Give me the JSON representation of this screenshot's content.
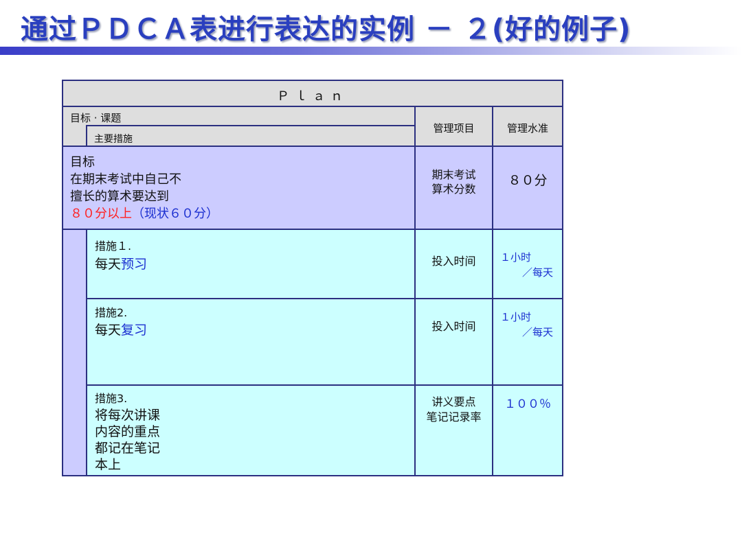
{
  "slide": {
    "title": "通过ＰＤＣＡ表进行表达的实例 － ２(好的例子)"
  },
  "table": {
    "header": "Ｐｌａｎ",
    "col1_header": "目标 · 课题",
    "col1_subheader": "主要措施",
    "col2_header": "管理项目",
    "col3_header": "管理水准",
    "goal": {
      "label": "目标",
      "line1": "在期末考试中自己不",
      "line2": "擅长的算术要达到",
      "target_red": "８０分以上",
      "status_blue": "（现状６０分）",
      "item_line1": "期末考试",
      "item_line2": "算术分数",
      "level": "８０分"
    },
    "measures": [
      {
        "label": "措施１.",
        "text_black": "每天",
        "text_blue": "预习",
        "item": "投入时间",
        "level_line1": "１小时",
        "level_line2": "／每天"
      },
      {
        "label": "措施2.",
        "text_black": "每天",
        "text_blue": "复习",
        "item": "投入时间",
        "level_line1": "１小时",
        "level_line2": "／每天"
      },
      {
        "label": "措施3.",
        "lines": [
          "将每次讲课",
          "内容的重点",
          "都记在笔记",
          "本上"
        ],
        "item_line1": "讲义要点",
        "item_line2": "笔记记录率",
        "level": "１００％"
      }
    ]
  }
}
